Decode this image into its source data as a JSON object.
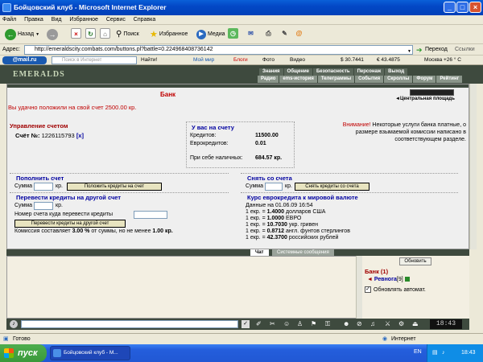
{
  "window": {
    "title": "Бойцовский клуб - Microsoft Internet Explorer"
  },
  "menu": [
    "Файл",
    "Правка",
    "Вид",
    "Избранное",
    "Сервис",
    "Справка"
  ],
  "toolbar": {
    "back": "Назад",
    "search": "Поиск",
    "favorites": "Избранное",
    "media": "Медиа"
  },
  "address": {
    "url": "http://emeraldscity.combats.com/buttons.pl?battle=0.224968408736142",
    "go": "Переход",
    "links": "Ссылки"
  },
  "mailbar": {
    "logo": "@mail.ru",
    "search_placeholder": "Поиск в Интернет",
    "find": "Найти!",
    "my_world": "Мой мир",
    "blogs": "Блоги",
    "photo": "Фото",
    "video": "Видео",
    "usd": "$ 30.7441",
    "eur": "€ 43.4875",
    "weather": "Москва +26 ° С"
  },
  "game": {
    "logo": "EMERALDS",
    "nav1": [
      "Знания",
      "Общение",
      "Безопасность",
      "Персонаж",
      "Выход"
    ],
    "nav2": [
      "Радио",
      "ems-история",
      "Телеграммы",
      "События",
      "Скроллы",
      "Форум",
      "Рейтинг"
    ]
  },
  "bank": {
    "title": "Банк",
    "success_msg": "Вы удачно положили на свой счет 2500.00 кр.",
    "central_square": "Центральная площадь",
    "account_heading": "Управление счетом",
    "account_label": "Счёт №:",
    "account_number": "1226115793",
    "account_close": "[x]",
    "balance_heading": "У вас на счету",
    "credits_label": "Кредитов:",
    "credits_value": "11500.00",
    "eurocredits_label": "Еврокредитов:",
    "eurocredits_value": "0.01",
    "cash_label": "При себе наличных:",
    "cash_value": "684.57 кр.",
    "notice_warn": "Внимание!",
    "notice_text": "Некоторые услуги банка платные, о размере взымаемой комиссии написано в соответствующем разделе.",
    "deposit_heading": "Пополнить счет",
    "sum_label": "Сумма",
    "kr": "кр.",
    "deposit_button": "Положить кредиты на счет",
    "withdraw_heading": "Снять со счета",
    "withdraw_button": "Снять кредиты со счета",
    "transfer_heading": "Перевести кредиты на другой счет",
    "transfer_account_label": "Номер счета куда перевести кредиты",
    "transfer_button": "Перевести кредиты на другой счет",
    "commission_prefix": "Комиссия составляет",
    "commission_pct": "3.00 %",
    "commission_mid": "от суммы, но не менее",
    "commission_min": "1.00 кр.",
    "rate_heading": "Курс еврокредита к мировой валюте",
    "rate_date": "Данные на 01.06.09 16:54",
    "rates": [
      {
        "prefix": "1 екр. =",
        "value": "1.4000",
        "currency": "долларов США"
      },
      {
        "prefix": "1 екр. =",
        "value": "1.0000",
        "currency": "ЕВРО"
      },
      {
        "prefix": "1 екр. =",
        "value": "10.7030",
        "currency": "укр. гривен"
      },
      {
        "prefix": "1 екр. =",
        "value": "0.8712",
        "currency": "англ. фунтов стерлингов"
      },
      {
        "prefix": "1 екр. =",
        "value": "42.3700",
        "currency": "российских рублей"
      }
    ]
  },
  "chat": {
    "tab_chat": "Чат",
    "tab_system": "Системные сообщения",
    "refresh_button": "Обновить",
    "location": "Банк (1)",
    "player_name": "Ревнога",
    "player_level": "[9]",
    "auto_refresh": "Обновлять автомат.",
    "clock": "18:43"
  },
  "status": {
    "ready": "Готово",
    "zone": "Интернет"
  },
  "taskbar": {
    "start": "пуск",
    "item": "Бойцовский клуб - M...",
    "lang": "EN",
    "time": "18:43"
  }
}
